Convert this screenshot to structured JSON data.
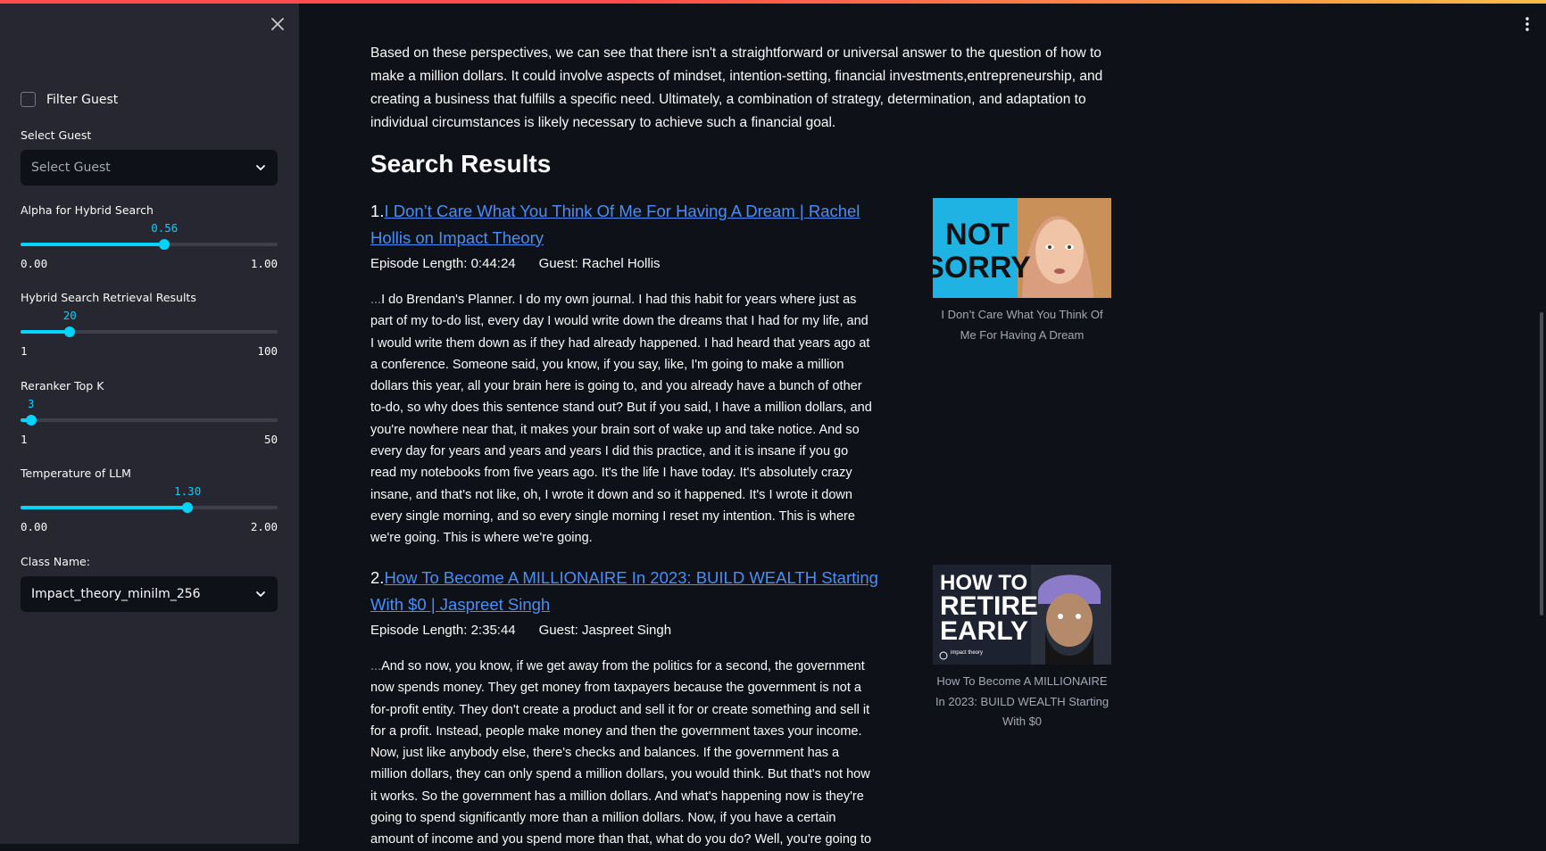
{
  "sidebar": {
    "filter_guest_label": "Filter Guest",
    "select_guest": {
      "label": "Select Guest",
      "value": "Select Guest"
    },
    "alpha": {
      "label": "Alpha for Hybrid Search",
      "value": "0.56",
      "min": "0.00",
      "max": "1.00",
      "fraction": 0.56
    },
    "retrieval": {
      "label": "Hybrid Search Retrieval Results",
      "value": "20",
      "min": "1",
      "max": "100",
      "fraction": 0.1919
    },
    "reranker": {
      "label": "Reranker Top K",
      "value": "3",
      "min": "1",
      "max": "50",
      "fraction": 0.0408
    },
    "temperature": {
      "label": "Temperature of LLM",
      "value": "1.30",
      "min": "0.00",
      "max": "2.00",
      "fraction": 0.65
    },
    "class_name": {
      "label": "Class Name:",
      "value": "Impact_theory_minilm_256"
    }
  },
  "main": {
    "summary": "Based on these perspectives, we can see that there isn't a straightforward or universal answer to the question of how to make a million dollars. It could involve aspects of mindset, intention-setting, financial investments,entrepreneurship, and creating a business that fulfills a specific need. Ultimately, a combination of strategy, determination, and adaptation to individual circumstances is likely necessary to achieve such a financial goal.",
    "heading": "Search Results",
    "results": [
      {
        "num": "1.",
        "title": "I Don’t Care What You Think Of Me For Having A Dream | Rachel Hollis on Impact Theory",
        "length": "Episode Length: 0:44:24",
        "guest": "Guest: Rachel Hollis",
        "ellipsis": "...",
        "excerpt": "I do Brendan's Planner. I do my own journal. I had this habit for years where just as part of my to-do list, every day I would write down the dreams that I had for my life, and I would write them down as if they had already happened. I had heard that years ago at a conference. Someone said, you know, if you say, like, I'm going to make a million dollars this year, all your brain here is going to, and you already have a bunch of other to-do, so why does this sentence stand out? But if you said, I have a million dollars, and you're nowhere near that, it makes your brain sort of wake up and take notice. And so every day for years and years and years I did this practice, and it is insane if you go read my notebooks from five years ago. It's the life I have today. It's absolutely crazy insane, and that's not like, oh, I wrote it down and so it happened. It's I wrote it down every single morning, and so every single morning I reset my intention. This is where we're going. This is where we're going.",
        "thumb_text": [
          "NOT",
          "SORRY"
        ],
        "caption": "I Don’t Care What You Think Of Me For Having A Dream"
      },
      {
        "num": "2.",
        "title": "How To Become A MILLIONAIRE In 2023: BUILD WEALTH Starting With $0 | Jaspreet Singh",
        "length": "Episode Length: 2:35:44",
        "guest": "Guest: Jaspreet Singh",
        "ellipsis": "...",
        "excerpt": "And so now, you know, if we get away from the politics for a second, the government now spends money. They get money from taxpayers because the government is not a for-profit entity. They don't create a product and sell it for or create something and sell it for a profit. Instead, people make money and then the government taxes your income. Now, just like anybody else, there's checks and balances. If the government has a million dollars, they can only spend a million dollars, you would think. But that's not how it works. So the government has a million dollars. And what's happening now is they're going to spend significantly more than a million dollars. Now, if you have a certain amount of income and you spend more than that, what do you do? Well, you're going to",
        "thumb_text": [
          "HOW TO",
          "RETIRE",
          "EARLY"
        ],
        "thumb_badge": "impact theory",
        "caption": "How To Become A MILLIONAIRE In 2023: BUILD WEALTH Starting With $0"
      }
    ]
  },
  "colors": {
    "accent": "#00d4ff",
    "link": "#4a8ef8",
    "sidebar_bg": "#262730",
    "main_bg": "#0e1117"
  },
  "icons": {
    "close": "close-icon",
    "menu": "kebab-menu-icon",
    "select_arrow": "chevron-down-icon"
  }
}
